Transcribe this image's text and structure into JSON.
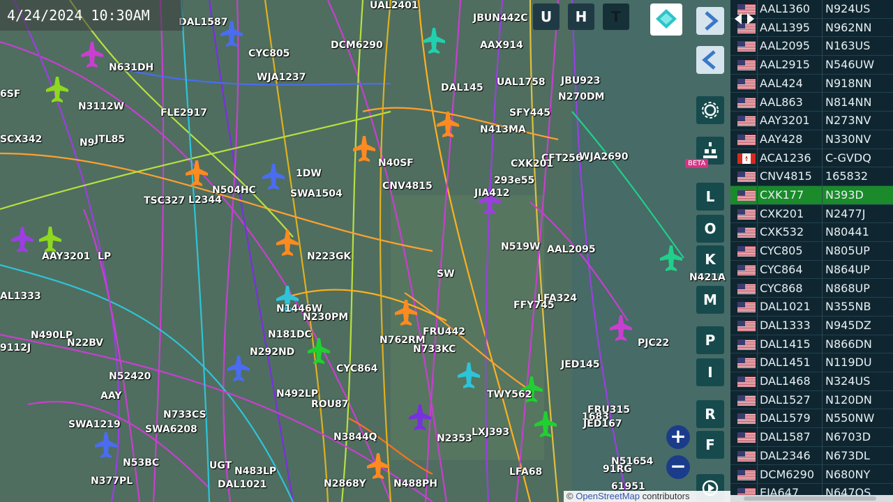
{
  "timestamp": "4/24/2024 10:30AM",
  "toolbar": {
    "u_label": "U",
    "h_label": "H",
    "t_label": "T"
  },
  "beta_badge": "BETA",
  "side_buttons": [
    "L",
    "O",
    "K",
    "M",
    "P",
    "I",
    "R",
    "F"
  ],
  "zoom": {
    "in_label": "+",
    "out_label": "−"
  },
  "attribution": {
    "prefix": "© ",
    "link": "OpenStreetMap",
    "suffix": " contributors"
  },
  "colors": {
    "usa_flag": "#b22234",
    "canada_flag": "#d52b1e",
    "selected_row": "#1a8a2a",
    "panel_bg": "#0f2630"
  },
  "map_labels": [
    {
      "text": "DAL1587"
    },
    {
      "text": "UAL2401"
    },
    {
      "text": "JBUN442C"
    },
    {
      "text": "DCM6290"
    },
    {
      "text": "AAX914"
    },
    {
      "text": "6SF"
    },
    {
      "text": "N631DH"
    },
    {
      "text": "CYC805"
    },
    {
      "text": "WJA1237"
    },
    {
      "text": "JBU923"
    },
    {
      "text": "N270DM"
    },
    {
      "text": "DAL145"
    },
    {
      "text": "UAL1758"
    },
    {
      "text": "N3112W"
    },
    {
      "text": "FLE2917"
    },
    {
      "text": "SFY445"
    },
    {
      "text": "N413MA"
    },
    {
      "text": "SCX342"
    },
    {
      "text": "N9"
    },
    {
      "text": "JTL85"
    },
    {
      "text": "CFT256"
    },
    {
      "text": "WJA2690"
    },
    {
      "text": "CXK201"
    },
    {
      "text": "N40SF"
    },
    {
      "text": "1DW"
    },
    {
      "text": "N504HC"
    },
    {
      "text": "SWA1504"
    },
    {
      "text": "TSC327"
    },
    {
      "text": "L2344"
    },
    {
      "text": "CNV4815"
    },
    {
      "text": "293e55"
    },
    {
      "text": "JIA412"
    },
    {
      "text": "AAY3201"
    },
    {
      "text": "LP"
    },
    {
      "text": "N223GK"
    },
    {
      "text": "N519W"
    },
    {
      "text": "AAL2095"
    },
    {
      "text": "N421A"
    },
    {
      "text": "AL1333"
    },
    {
      "text": "SW"
    },
    {
      "text": "LFA324"
    },
    {
      "text": "N1446W"
    },
    {
      "text": "N230PM"
    },
    {
      "text": "FFY745"
    },
    {
      "text": "N181DC"
    },
    {
      "text": "PJC22"
    },
    {
      "text": "N490LP"
    },
    {
      "text": "FRU442"
    },
    {
      "text": "9112J"
    },
    {
      "text": "N22BV"
    },
    {
      "text": "N292ND"
    },
    {
      "text": "N762RM"
    },
    {
      "text": "N733KC"
    },
    {
      "text": "JED145"
    },
    {
      "text": "N52420"
    },
    {
      "text": "CYC864"
    },
    {
      "text": "N492LP"
    },
    {
      "text": "ROU87"
    },
    {
      "text": "AAY"
    },
    {
      "text": "TWY562"
    },
    {
      "text": "N733CS"
    },
    {
      "text": "FRU315"
    },
    {
      "text": "SWA1219"
    },
    {
      "text": "SWA6208"
    },
    {
      "text": "N3844Q"
    },
    {
      "text": "N2353"
    },
    {
      "text": "LXJ393"
    },
    {
      "text": "1683"
    },
    {
      "text": "JED167"
    },
    {
      "text": "N53BC"
    },
    {
      "text": "N483LP"
    },
    {
      "text": "N51654"
    },
    {
      "text": "N377PL"
    },
    {
      "text": "DAL1021"
    },
    {
      "text": "N2868Y"
    },
    {
      "text": "N488PH"
    },
    {
      "text": "LFA68"
    },
    {
      "text": "91RG"
    },
    {
      "text": "61951"
    },
    {
      "text": "UGT"
    }
  ],
  "flight_list": [
    {
      "callsign": "AAL1360",
      "reg": "N924US",
      "country": "USA"
    },
    {
      "callsign": "AAL1395",
      "reg": "N962NN",
      "country": "USA"
    },
    {
      "callsign": "AAL2095",
      "reg": "N163US",
      "country": "USA"
    },
    {
      "callsign": "AAL2915",
      "reg": "N546UW",
      "country": "USA"
    },
    {
      "callsign": "AAL424",
      "reg": "N918NN",
      "country": "USA"
    },
    {
      "callsign": "AAL863",
      "reg": "N814NN",
      "country": "USA"
    },
    {
      "callsign": "AAY3201",
      "reg": "N273NV",
      "country": "USA"
    },
    {
      "callsign": "AAY428",
      "reg": "N330NV",
      "country": "USA"
    },
    {
      "callsign": "ACA1236",
      "reg": "C-GVDQ",
      "country": "Canada"
    },
    {
      "callsign": "CNV4815",
      "reg": "165832",
      "country": "USA"
    },
    {
      "callsign": "CXK177",
      "reg": "N393D",
      "country": "USA",
      "selected": true
    },
    {
      "callsign": "CXK201",
      "reg": "N2477J",
      "country": "USA"
    },
    {
      "callsign": "CXK532",
      "reg": "N80441",
      "country": "USA"
    },
    {
      "callsign": "CYC805",
      "reg": "N805UP",
      "country": "USA"
    },
    {
      "callsign": "CYC864",
      "reg": "N864UP",
      "country": "USA"
    },
    {
      "callsign": "CYC868",
      "reg": "N868UP",
      "country": "USA"
    },
    {
      "callsign": "DAL1021",
      "reg": "N355NB",
      "country": "USA"
    },
    {
      "callsign": "DAL1333",
      "reg": "N945DZ",
      "country": "USA"
    },
    {
      "callsign": "DAL1415",
      "reg": "N866DN",
      "country": "USA"
    },
    {
      "callsign": "DAL1451",
      "reg": "N119DU",
      "country": "USA"
    },
    {
      "callsign": "DAL1468",
      "reg": "N324US",
      "country": "USA"
    },
    {
      "callsign": "DAL1527",
      "reg": "N120DN",
      "country": "USA"
    },
    {
      "callsign": "DAL1579",
      "reg": "N550NW",
      "country": "USA"
    },
    {
      "callsign": "DAL1587",
      "reg": "N6703D",
      "country": "USA"
    },
    {
      "callsign": "DAL2346",
      "reg": "N673DL",
      "country": "USA"
    },
    {
      "callsign": "DCM6290",
      "reg": "N680NY",
      "country": "USA"
    },
    {
      "callsign": "EJA647",
      "reg": "N647QS",
      "country": "USA"
    }
  ]
}
